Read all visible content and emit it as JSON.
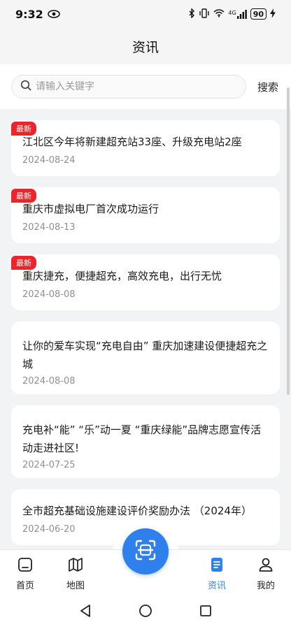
{
  "status_bar": {
    "time": "9:32",
    "battery": "90",
    "signal_label": "4G"
  },
  "header": {
    "title": "资讯"
  },
  "search": {
    "placeholder": "请输入关键字",
    "button_label": "搜索"
  },
  "news": [
    {
      "badge": "最新",
      "title": "江北区今年将新建超充站33座、升级充电站2座",
      "date": "2024-08-24"
    },
    {
      "badge": "最新",
      "title": "重庆市虚拟电厂首次成功运行",
      "date": "2024-08-13"
    },
    {
      "badge": "最新",
      "title": "重庆捷充，便捷超充，高效充电，出行无忧",
      "date": "2024-08-08"
    },
    {
      "badge": "",
      "title": "让你的爱车实现“充电自由” 重庆加速建设便捷超充之城",
      "date": "2024-08-08"
    },
    {
      "badge": "",
      "title": "充电补“能” “乐”动一夏 “重庆绿能”品牌志愿宣传活动走进社区!",
      "date": "2024-07-25"
    },
    {
      "badge": "",
      "title": "全市超充基础设施建设评价奖励办法 （2024年）",
      "date": "2024-06-20"
    }
  ],
  "tabs": [
    {
      "label": "首页",
      "icon": "home-icon"
    },
    {
      "label": "地图",
      "icon": "map-icon"
    },
    {
      "label": "资讯",
      "icon": "news-icon",
      "active": true
    },
    {
      "label": "我的",
      "icon": "profile-icon"
    }
  ],
  "colors": {
    "accent": "#2f80ed",
    "badge": "#e8262b"
  }
}
